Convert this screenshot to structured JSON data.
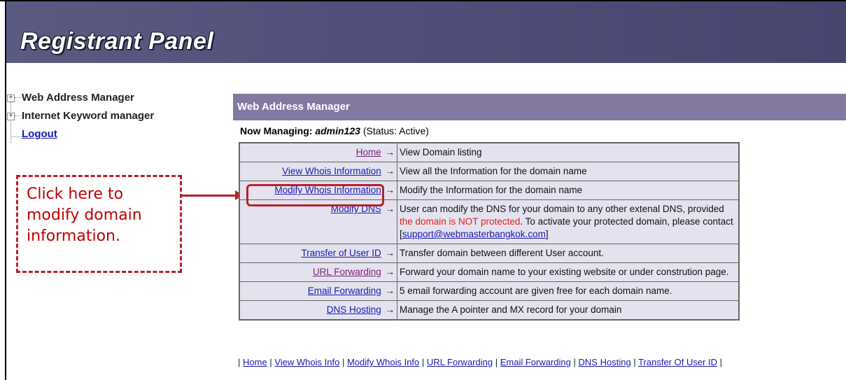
{
  "banner": {
    "title": "Registrant Panel"
  },
  "sidebar": {
    "items": [
      {
        "label": "Web Address Manager"
      },
      {
        "label": "Internet Keyword manager"
      }
    ],
    "logout_label": "Logout"
  },
  "callout": {
    "text": "Click here to modify domain information."
  },
  "main": {
    "section_title": "Web Address Manager",
    "now_managing_label": "Now Managing:",
    "user": "admin123",
    "status": "(Status: Active)",
    "arrow": "→",
    "rows": [
      {
        "link": "Home",
        "desc": "View Domain listing"
      },
      {
        "link": "View Whois Information",
        "desc": "View all the Information for the domain name"
      },
      {
        "link": "Modify Whois Information",
        "desc": "Modify the Information for the domain name"
      },
      {
        "link": "Modify DNS",
        "desc_a": "User can modify the DNS for your domain to any other extenal DNS, provided ",
        "desc_red": "the domain is NOT protected",
        "desc_b": ". To activate your protected domain, please contact [",
        "email": "support@webmasterbangkok.com",
        "desc_c": "]"
      },
      {
        "link": "Transfer of User ID",
        "desc": "Transfer domain between different User account."
      },
      {
        "link": "URL Forwarding",
        "desc": "Forward your domain name to your existing website or under constrution page."
      },
      {
        "link": "Email Forwarding",
        "desc": "5 email forwarding account are given free for each domain name."
      },
      {
        "link": "DNS Hosting",
        "desc": "Manage the A pointer and MX record for your domain"
      }
    ]
  },
  "footer": {
    "links": [
      "Home",
      "View Whois Info",
      "Modify Whois Info",
      "URL Forwarding",
      "Email Forwarding",
      "DNS Hosting",
      "Transfer Of User ID"
    ],
    "separator": "|"
  }
}
